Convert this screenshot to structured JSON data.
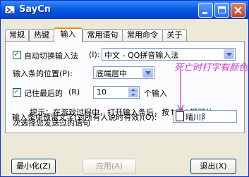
{
  "window": {
    "title": "SayCn"
  },
  "tabs": [
    {
      "label": "常规"
    },
    {
      "label": "热键"
    },
    {
      "label": "输入"
    },
    {
      "label": "常用语句"
    },
    {
      "label": "常用命令"
    },
    {
      "label": "关于"
    }
  ],
  "input_tab": {
    "auto_switch_label": "自动切换输入法",
    "auto_switch_shortcut": "(I):",
    "ime_value": "中文 - QQ拼音输入法",
    "position_label": "输入条的位置(P):",
    "position_value": "底端居中",
    "remember_label": "记住最后的",
    "remember_shortcut": "(R)",
    "remember_count": "10",
    "remember_unit": "个输入",
    "hint_line1": "提示：在游戏过程中，打开输入条后，按↑或↓键可依",
    "hint_line2": "次选择您发送过的语句",
    "preset_label": "输入条中预留文字(对所有人说时有效)(O):",
    "preset_value": "晴川阝"
  },
  "annotation": {
    "text": "死亡时打字有颜色"
  },
  "buttons": {
    "minimize": "最小化(Z)",
    "apply": "应用(A)",
    "exit": "退出(X)"
  },
  "colors": {
    "annotation": "#cc33cc",
    "title_bar": "#0a5ee6",
    "active_tab_accent": "#e68b2c"
  }
}
